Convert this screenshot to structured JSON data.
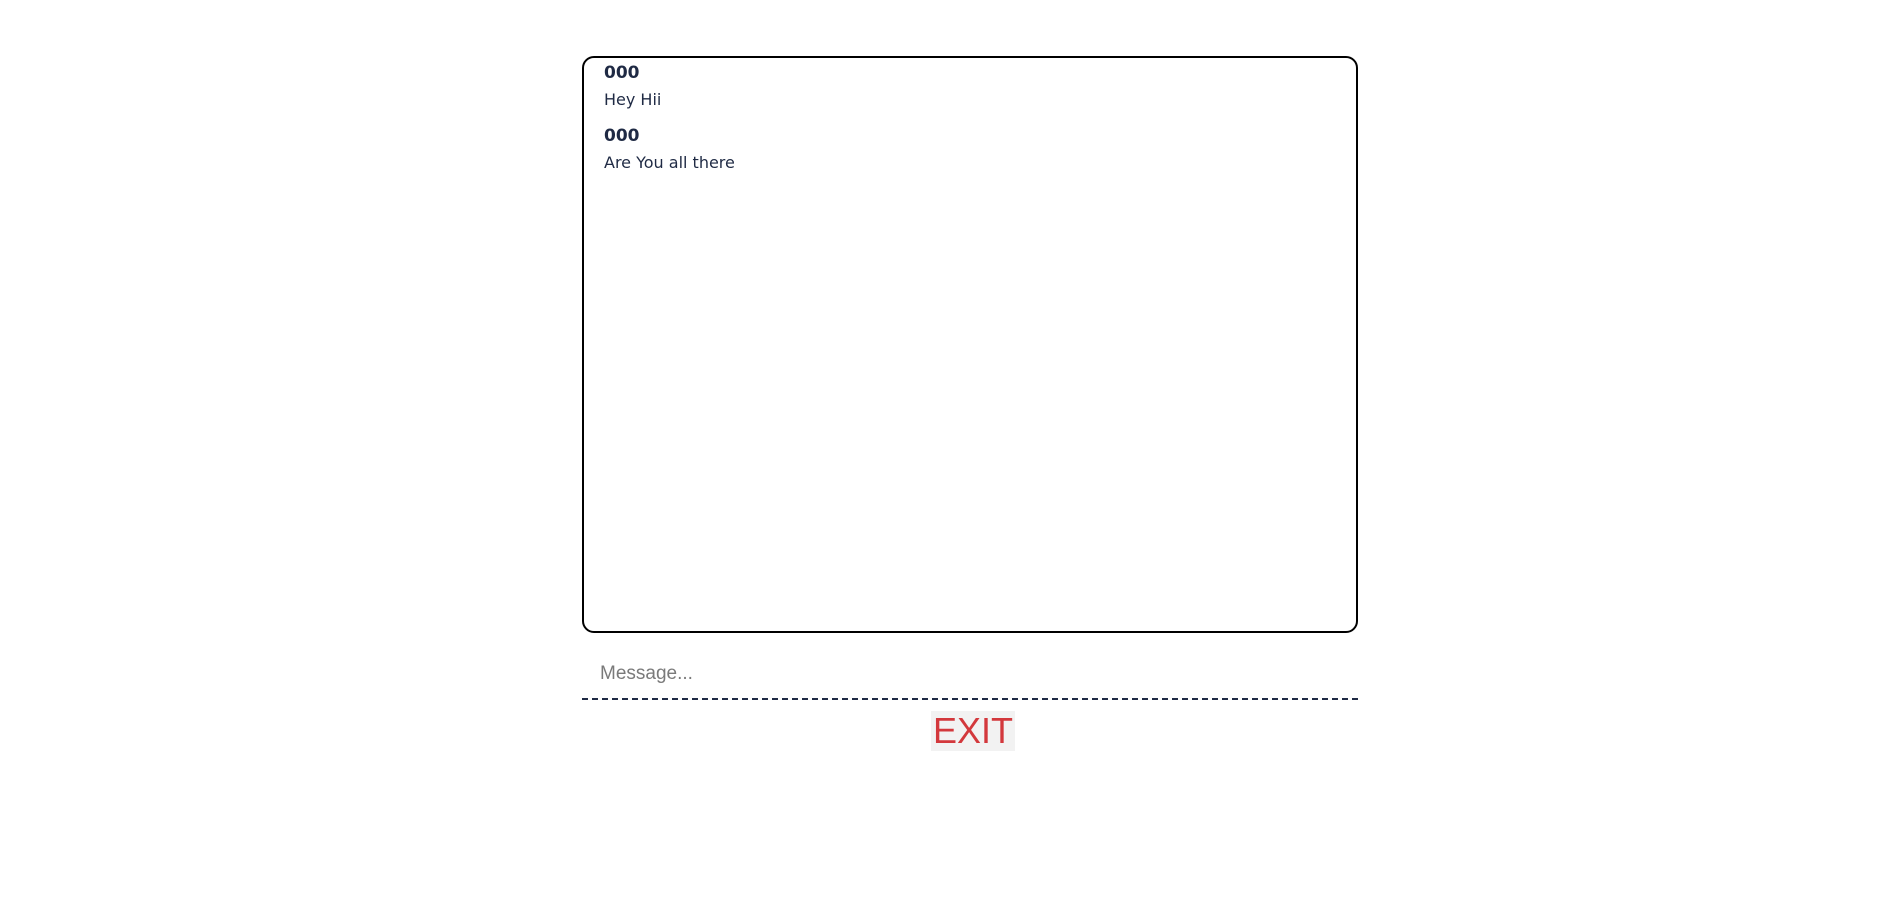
{
  "chat": {
    "messages": [
      {
        "sender": "000",
        "text": "Hey Hii"
      },
      {
        "sender": "000",
        "text": "Are You all there"
      }
    ]
  },
  "composer": {
    "placeholder": "Message...",
    "value": ""
  },
  "actions": {
    "exit_label": "EXIT"
  },
  "colors": {
    "text": "#1f2a44",
    "exit": "#d3383c",
    "border": "#000000"
  }
}
